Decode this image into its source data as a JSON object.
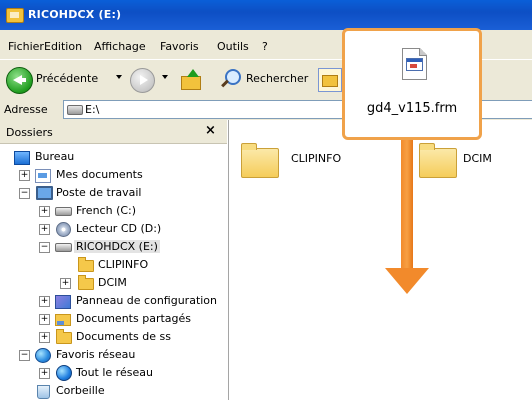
{
  "window": {
    "title": "RICOHDCX (E:)"
  },
  "menu": [
    "Fichier",
    "Edition",
    "Affichage",
    "Favoris",
    "Outils",
    "?"
  ],
  "toolbar": {
    "back_label": "Précédente",
    "search_label": "Rechercher"
  },
  "address": {
    "label": "Adresse",
    "value": "E:\\"
  },
  "folders_pane": {
    "title": "Dossiers",
    "close": "×",
    "tree": [
      {
        "label": "Bureau",
        "icon": "desktop-icon"
      },
      {
        "label": "Mes documents",
        "icon": "documents-icon",
        "expander": "+"
      },
      {
        "label": "Poste de travail",
        "icon": "computer-icon",
        "expander": "−"
      },
      {
        "label": "French (C:)",
        "icon": "drive-icon",
        "expander": "+"
      },
      {
        "label": "Lecteur CD (D:)",
        "icon": "cd-drive-icon",
        "expander": "+"
      },
      {
        "label": "RICOHDCX (E:)",
        "icon": "drive-icon",
        "expander": "−",
        "selected": true
      },
      {
        "label": "CLIPINFO",
        "icon": "folder-icon"
      },
      {
        "label": "DCIM",
        "icon": "folder-icon",
        "expander": "+"
      },
      {
        "label": "Panneau de configuration",
        "icon": "control-panel-icon",
        "expander": "+"
      },
      {
        "label": "Documents partagés",
        "icon": "shared-folder-icon",
        "expander": "+"
      },
      {
        "label": "Documents de ss",
        "icon": "folder-icon",
        "expander": "+"
      },
      {
        "label": "Favoris réseau",
        "icon": "network-icon",
        "expander": "−"
      },
      {
        "label": "Tout le réseau",
        "icon": "globe-icon",
        "expander": "+"
      },
      {
        "label": "Corbeille",
        "icon": "recycle-bin-icon"
      }
    ]
  },
  "content": {
    "items": [
      {
        "name": "CLIPINFO",
        "icon": "folder-icon"
      },
      {
        "name": "DCIM",
        "icon": "folder-icon"
      }
    ]
  },
  "callout": {
    "filename": "gd4_v115.frm",
    "icon": "frm-file-icon",
    "arrow_color": "#f28a2b",
    "border_color": "#f0a24a"
  }
}
